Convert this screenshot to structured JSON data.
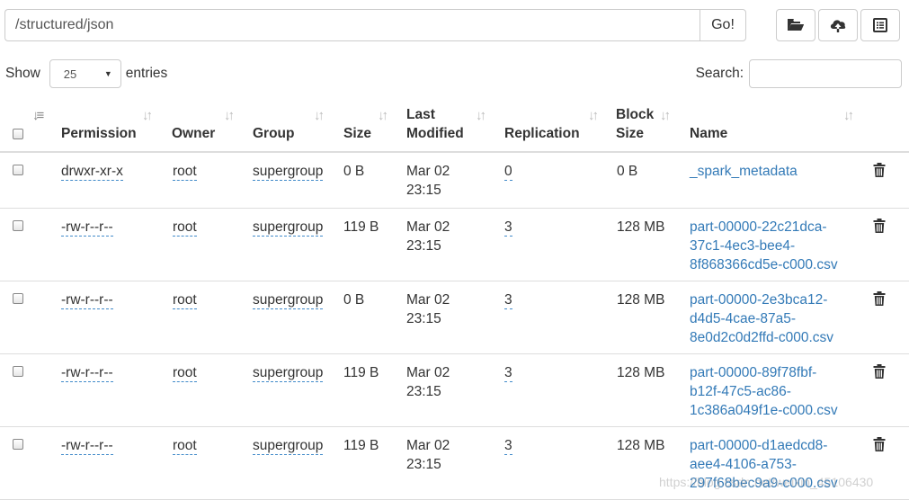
{
  "toolbar": {
    "path_value": "/structured/json",
    "go_label": "Go!",
    "icons": [
      "folder-open-icon",
      "cloud-upload-icon",
      "list-alt-icon"
    ]
  },
  "controls": {
    "show_label": "Show",
    "page_size": "25",
    "entries_label": "entries",
    "search_label": "Search:",
    "search_value": ""
  },
  "table": {
    "headers": {
      "permission": "Permission",
      "owner": "Owner",
      "group": "Group",
      "size": "Size",
      "last_modified_1": "Last",
      "last_modified_2": "Modified",
      "replication": "Replication",
      "block_size_1": "Block",
      "block_size_2": "Size",
      "name": "Name"
    },
    "rows": [
      {
        "permission": "drwxr-xr-x",
        "owner": "root",
        "group": "supergroup",
        "size": "0 B",
        "date": "Mar 02",
        "time": "23:15",
        "replication": "0",
        "block_size": "0 B",
        "name_lines": [
          "_spark_metadata"
        ]
      },
      {
        "permission": "-rw-r--r--",
        "owner": "root",
        "group": "supergroup",
        "size": "119 B",
        "date": "Mar 02",
        "time": "23:15",
        "replication": "3",
        "block_size": "128 MB",
        "name_lines": [
          "part-00000-22c21dca-",
          "37c1-4ec3-bee4-",
          "8f868366cd5e-c000.csv"
        ]
      },
      {
        "permission": "-rw-r--r--",
        "owner": "root",
        "group": "supergroup",
        "size": "0 B",
        "date": "Mar 02",
        "time": "23:15",
        "replication": "3",
        "block_size": "128 MB",
        "name_lines": [
          "part-00000-2e3bca12-",
          "d4d5-4cae-87a5-",
          "8e0d2c0d2ffd-c000.csv"
        ]
      },
      {
        "permission": "-rw-r--r--",
        "owner": "root",
        "group": "supergroup",
        "size": "119 B",
        "date": "Mar 02",
        "time": "23:15",
        "replication": "3",
        "block_size": "128 MB",
        "name_lines": [
          "part-00000-89f78fbf-",
          "b12f-47c5-ac86-",
          "1c386a049f1e-c000.csv"
        ]
      },
      {
        "permission": "-rw-r--r--",
        "owner": "root",
        "group": "supergroup",
        "size": "119 B",
        "date": "Mar 02",
        "time": "23:15",
        "replication": "3",
        "block_size": "128 MB",
        "name_lines": [
          "part-00000-d1aedcd8-",
          "aee4-4106-a753-",
          "297f68bec9a9-c000.csv"
        ]
      }
    ]
  },
  "watermark": "https://blog.csdn.net/weixin_45106430",
  "colors": {
    "link": "#337ab7",
    "dotted_underline": "#428bca",
    "border": "#ddd"
  }
}
